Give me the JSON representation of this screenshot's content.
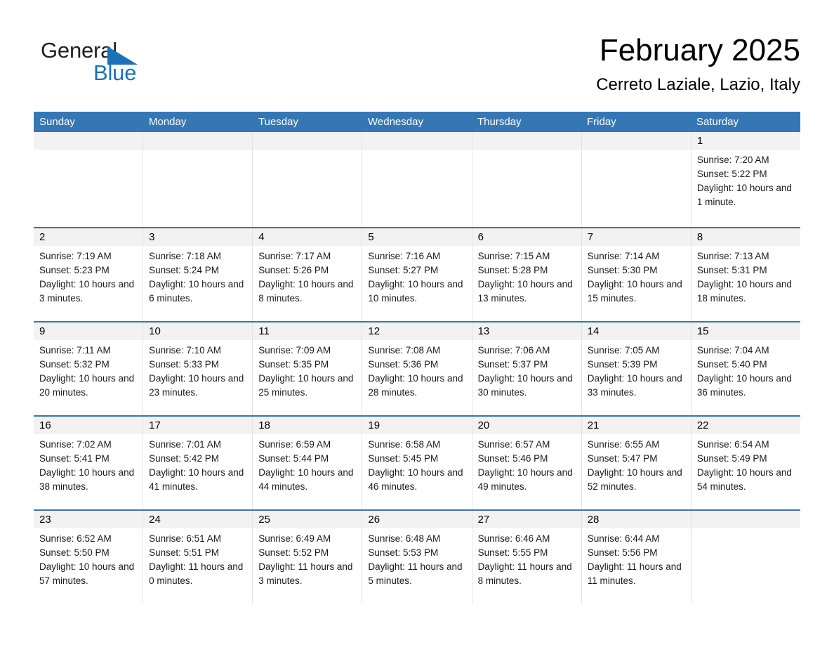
{
  "brand": {
    "name_part1": "General",
    "name_part2": "Blue",
    "logo_icon": "triangle-logo-icon",
    "accent_color": "#1a72b8"
  },
  "header": {
    "month_title": "February 2025",
    "location": "Cerreto Laziale, Lazio, Italy"
  },
  "calendar": {
    "header_color": "#3577b5",
    "daynum_band_color": "#f2f2f2",
    "weekdays": [
      "Sunday",
      "Monday",
      "Tuesday",
      "Wednesday",
      "Thursday",
      "Friday",
      "Saturday"
    ],
    "weeks": [
      [
        {
          "day": "",
          "sunrise": "",
          "sunset": "",
          "daylight": "",
          "empty": true
        },
        {
          "day": "",
          "sunrise": "",
          "sunset": "",
          "daylight": "",
          "empty": true
        },
        {
          "day": "",
          "sunrise": "",
          "sunset": "",
          "daylight": "",
          "empty": true
        },
        {
          "day": "",
          "sunrise": "",
          "sunset": "",
          "daylight": "",
          "empty": true
        },
        {
          "day": "",
          "sunrise": "",
          "sunset": "",
          "daylight": "",
          "empty": true
        },
        {
          "day": "",
          "sunrise": "",
          "sunset": "",
          "daylight": "",
          "empty": true
        },
        {
          "day": "1",
          "sunrise": "Sunrise: 7:20 AM",
          "sunset": "Sunset: 5:22 PM",
          "daylight": "Daylight: 10 hours and 1 minute.",
          "empty": false
        }
      ],
      [
        {
          "day": "2",
          "sunrise": "Sunrise: 7:19 AM",
          "sunset": "Sunset: 5:23 PM",
          "daylight": "Daylight: 10 hours and 3 minutes.",
          "empty": false
        },
        {
          "day": "3",
          "sunrise": "Sunrise: 7:18 AM",
          "sunset": "Sunset: 5:24 PM",
          "daylight": "Daylight: 10 hours and 6 minutes.",
          "empty": false
        },
        {
          "day": "4",
          "sunrise": "Sunrise: 7:17 AM",
          "sunset": "Sunset: 5:26 PM",
          "daylight": "Daylight: 10 hours and 8 minutes.",
          "empty": false
        },
        {
          "day": "5",
          "sunrise": "Sunrise: 7:16 AM",
          "sunset": "Sunset: 5:27 PM",
          "daylight": "Daylight: 10 hours and 10 minutes.",
          "empty": false
        },
        {
          "day": "6",
          "sunrise": "Sunrise: 7:15 AM",
          "sunset": "Sunset: 5:28 PM",
          "daylight": "Daylight: 10 hours and 13 minutes.",
          "empty": false
        },
        {
          "day": "7",
          "sunrise": "Sunrise: 7:14 AM",
          "sunset": "Sunset: 5:30 PM",
          "daylight": "Daylight: 10 hours and 15 minutes.",
          "empty": false
        },
        {
          "day": "8",
          "sunrise": "Sunrise: 7:13 AM",
          "sunset": "Sunset: 5:31 PM",
          "daylight": "Daylight: 10 hours and 18 minutes.",
          "empty": false
        }
      ],
      [
        {
          "day": "9",
          "sunrise": "Sunrise: 7:11 AM",
          "sunset": "Sunset: 5:32 PM",
          "daylight": "Daylight: 10 hours and 20 minutes.",
          "empty": false
        },
        {
          "day": "10",
          "sunrise": "Sunrise: 7:10 AM",
          "sunset": "Sunset: 5:33 PM",
          "daylight": "Daylight: 10 hours and 23 minutes.",
          "empty": false
        },
        {
          "day": "11",
          "sunrise": "Sunrise: 7:09 AM",
          "sunset": "Sunset: 5:35 PM",
          "daylight": "Daylight: 10 hours and 25 minutes.",
          "empty": false
        },
        {
          "day": "12",
          "sunrise": "Sunrise: 7:08 AM",
          "sunset": "Sunset: 5:36 PM",
          "daylight": "Daylight: 10 hours and 28 minutes.",
          "empty": false
        },
        {
          "day": "13",
          "sunrise": "Sunrise: 7:06 AM",
          "sunset": "Sunset: 5:37 PM",
          "daylight": "Daylight: 10 hours and 30 minutes.",
          "empty": false
        },
        {
          "day": "14",
          "sunrise": "Sunrise: 7:05 AM",
          "sunset": "Sunset: 5:39 PM",
          "daylight": "Daylight: 10 hours and 33 minutes.",
          "empty": false
        },
        {
          "day": "15",
          "sunrise": "Sunrise: 7:04 AM",
          "sunset": "Sunset: 5:40 PM",
          "daylight": "Daylight: 10 hours and 36 minutes.",
          "empty": false
        }
      ],
      [
        {
          "day": "16",
          "sunrise": "Sunrise: 7:02 AM",
          "sunset": "Sunset: 5:41 PM",
          "daylight": "Daylight: 10 hours and 38 minutes.",
          "empty": false
        },
        {
          "day": "17",
          "sunrise": "Sunrise: 7:01 AM",
          "sunset": "Sunset: 5:42 PM",
          "daylight": "Daylight: 10 hours and 41 minutes.",
          "empty": false
        },
        {
          "day": "18",
          "sunrise": "Sunrise: 6:59 AM",
          "sunset": "Sunset: 5:44 PM",
          "daylight": "Daylight: 10 hours and 44 minutes.",
          "empty": false
        },
        {
          "day": "19",
          "sunrise": "Sunrise: 6:58 AM",
          "sunset": "Sunset: 5:45 PM",
          "daylight": "Daylight: 10 hours and 46 minutes.",
          "empty": false
        },
        {
          "day": "20",
          "sunrise": "Sunrise: 6:57 AM",
          "sunset": "Sunset: 5:46 PM",
          "daylight": "Daylight: 10 hours and 49 minutes.",
          "empty": false
        },
        {
          "day": "21",
          "sunrise": "Sunrise: 6:55 AM",
          "sunset": "Sunset: 5:47 PM",
          "daylight": "Daylight: 10 hours and 52 minutes.",
          "empty": false
        },
        {
          "day": "22",
          "sunrise": "Sunrise: 6:54 AM",
          "sunset": "Sunset: 5:49 PM",
          "daylight": "Daylight: 10 hours and 54 minutes.",
          "empty": false
        }
      ],
      [
        {
          "day": "23",
          "sunrise": "Sunrise: 6:52 AM",
          "sunset": "Sunset: 5:50 PM",
          "daylight": "Daylight: 10 hours and 57 minutes.",
          "empty": false
        },
        {
          "day": "24",
          "sunrise": "Sunrise: 6:51 AM",
          "sunset": "Sunset: 5:51 PM",
          "daylight": "Daylight: 11 hours and 0 minutes.",
          "empty": false
        },
        {
          "day": "25",
          "sunrise": "Sunrise: 6:49 AM",
          "sunset": "Sunset: 5:52 PM",
          "daylight": "Daylight: 11 hours and 3 minutes.",
          "empty": false
        },
        {
          "day": "26",
          "sunrise": "Sunrise: 6:48 AM",
          "sunset": "Sunset: 5:53 PM",
          "daylight": "Daylight: 11 hours and 5 minutes.",
          "empty": false
        },
        {
          "day": "27",
          "sunrise": "Sunrise: 6:46 AM",
          "sunset": "Sunset: 5:55 PM",
          "daylight": "Daylight: 11 hours and 8 minutes.",
          "empty": false
        },
        {
          "day": "28",
          "sunrise": "Sunrise: 6:44 AM",
          "sunset": "Sunset: 5:56 PM",
          "daylight": "Daylight: 11 hours and 11 minutes.",
          "empty": false
        },
        {
          "day": "",
          "sunrise": "",
          "sunset": "",
          "daylight": "",
          "empty": true
        }
      ]
    ]
  }
}
